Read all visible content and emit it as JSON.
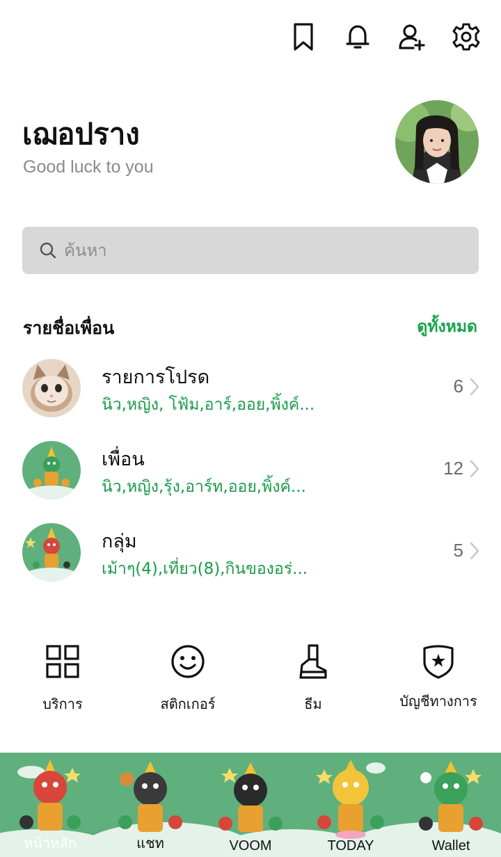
{
  "header": {
    "icons": [
      "bookmark-icon",
      "bell-icon",
      "add-friend-icon",
      "gear-icon"
    ]
  },
  "profile": {
    "name": "เฌอปราง",
    "status": "Good luck to you"
  },
  "search": {
    "placeholder": "ค้นหา"
  },
  "friends_section": {
    "title": "รายชื่อเพื่อน",
    "see_all": "ดูทั้งหมด",
    "rows": [
      {
        "title": "รายการโปรด",
        "subtitle": "นิว,หญิง, โฟ้ม,อาร์,ออย,พิ้งค์...",
        "count": "6"
      },
      {
        "title": "เพื่อน",
        "subtitle": "นิว,หญิง,รุ้ง,อาร์ท,ออย,พิ้งค์...",
        "count": "12"
      },
      {
        "title": "กลุ่ม",
        "subtitle": "เม้าๆ(4),เที่ยว(8),กินของอร่...",
        "count": "5"
      }
    ]
  },
  "services": [
    {
      "label": "บริการ",
      "icon": "grid-icon"
    },
    {
      "label": "สติกเกอร์",
      "icon": "smiley-icon"
    },
    {
      "label": "ธีม",
      "icon": "brush-icon"
    },
    {
      "label": "บัญชีทางการ",
      "icon": "shield-star-icon"
    }
  ],
  "bottom_nav": {
    "tabs": [
      "หน้าหลัก",
      "แชท",
      "VOOM",
      "TODAY",
      "Wallet"
    ]
  },
  "colors": {
    "accent_green": "#17a34a",
    "bottom_bar": "#5fb07c"
  }
}
